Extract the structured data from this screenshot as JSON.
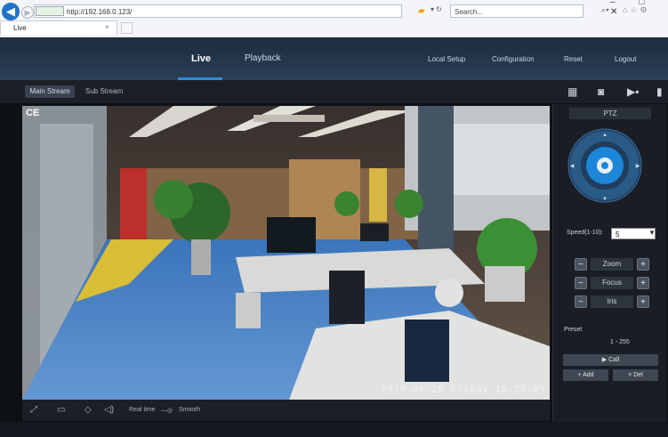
{
  "browser": {
    "url": "http://192.168.0.123/",
    "search_placeholder": "Search...",
    "tab_title": "Live",
    "window_controls": "‒ □ ✕"
  },
  "nav": {
    "live": "Live",
    "playback": "Playback",
    "local_setup": "Local Setup",
    "configuration": "Configuration",
    "reset": "Reset",
    "logout": "Logout"
  },
  "stream_tabs": {
    "main": "Main Stream",
    "sub": "Sub Stream"
  },
  "video": {
    "camera_label": "CE",
    "timestamp": "2019-06-28 Friday 10:25:05"
  },
  "bottom": {
    "realtime": "Real time",
    "smooth": "Smooth"
  },
  "ptz": {
    "title": "PTZ",
    "speed_label": "Speed(1-10):",
    "speed_value": "5",
    "zoom": "Zoom",
    "focus": "Focus",
    "iris": "Iris",
    "minus": "−",
    "plus": "+",
    "preset_label": "Preset",
    "preset_range": "1 - 255",
    "call": "▶ Call",
    "add": "+ Add",
    "del": "× Del"
  },
  "colors": {
    "accent": "#2a8fe0",
    "nav_bg": "#1e2c3e",
    "panel_bg": "#1a1e24"
  }
}
